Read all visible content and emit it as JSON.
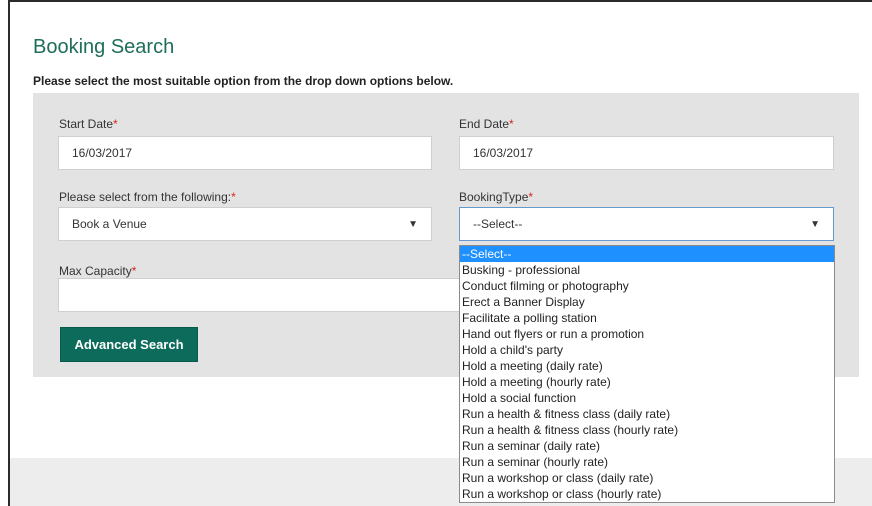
{
  "title": "Booking Search",
  "instructions": "Please select the most suitable option from the drop down options below.",
  "fields": {
    "start_date": {
      "label": "Start Date",
      "required": "*",
      "value": "16/03/2017"
    },
    "end_date": {
      "label": "End Date",
      "required": "*",
      "value": "16/03/2017"
    },
    "select_following": {
      "label": "Please select from the following:",
      "required": "*",
      "value": "Book a Venue"
    },
    "booking_type": {
      "label": "BookingType",
      "required": "*",
      "value": "--Select--"
    },
    "max_capacity": {
      "label": "Max Capacity",
      "required": "*",
      "value": ""
    }
  },
  "buttons": {
    "advanced_search": "Advanced Search"
  },
  "booking_type_options": [
    "--Select--",
    "Busking - professional",
    "Conduct filming or photography",
    "Erect a Banner Display",
    "Facilitate a polling station",
    "Hand out flyers or run a promotion",
    "Hold a child's party",
    "Hold a meeting (daily rate)",
    "Hold a meeting (hourly rate)",
    "Hold a social function",
    "Run a health & fitness class (daily rate)",
    "Run a health & fitness class (hourly rate)",
    "Run a seminar (daily rate)",
    "Run a seminar (hourly rate)",
    "Run a workshop or class (daily rate)",
    "Run a workshop or class (hourly rate)"
  ],
  "icons": {
    "select_caret": "chevron-down-icon"
  },
  "colors": {
    "accent": "#0c6b5a",
    "title": "#1f6e5a",
    "required": "#d9261c",
    "highlight": "#1e90ff"
  }
}
